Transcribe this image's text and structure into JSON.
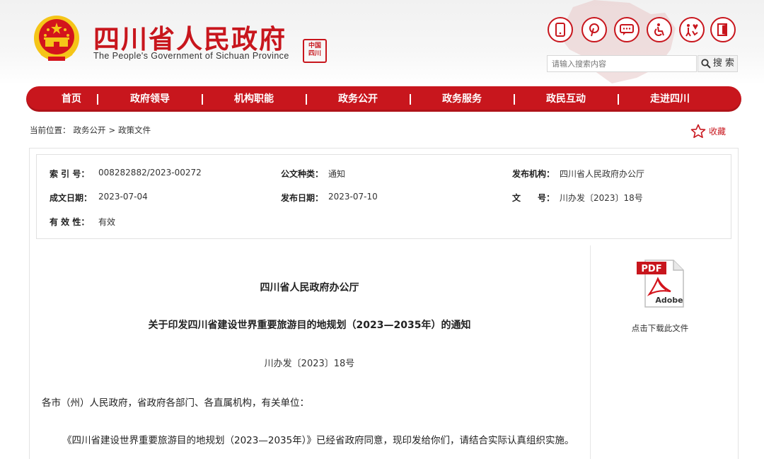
{
  "header": {
    "title": "四川省人民政府",
    "subtitle": "The People's Government of Sichuan Province",
    "seal_text": "中国四川",
    "icons": [
      "mobile-icon",
      "pinterest-icon",
      "message-icon",
      "accessibility-icon",
      "care-icon",
      "exit-icon"
    ]
  },
  "search": {
    "placeholder": "请输入搜索内容",
    "button_label": "搜 索"
  },
  "nav": {
    "items": [
      {
        "label": "首页"
      },
      {
        "label": "政府领导"
      },
      {
        "label": "机构职能"
      },
      {
        "label": "政务公开"
      },
      {
        "label": "政务服务"
      },
      {
        "label": "政民互动"
      },
      {
        "label": "走进四川"
      }
    ]
  },
  "breadcrumb": {
    "prefix": "当前位置：",
    "items": [
      "政务公开",
      "政策文件"
    ],
    "separator": ">"
  },
  "favorite_label": "收藏",
  "meta": {
    "index_label": "索 引 号：",
    "index_value": "008282882/2023-00272",
    "category_label": "公文种类：",
    "category_value": "通知",
    "issuer_label": "发布机构：",
    "issuer_value": "四川省人民政府办公厅",
    "created_label": "成文日期：",
    "created_value": "2023-07-04",
    "published_label": "发布日期：",
    "published_value": "2023-07-10",
    "docno_label": "文　　号：",
    "docno_value": "川办发〔2023〕18号",
    "validity_label": "有 效 性：",
    "validity_value": "有效"
  },
  "document": {
    "issuer": "四川省人民政府办公厅",
    "title": "关于印发四川省建设世界重要旅游目的地规划（2023—2035年）的通知",
    "number": "川办发〔2023〕18号",
    "salutation": "各市（州）人民政府，省政府各部门、各直属机构，有关单位：",
    "body": "《四川省建设世界重要旅游目的地规划（2023—2035年）》已经省政府同意，现印发给你们，请结合实际认真组织实施。"
  },
  "download": {
    "pdf_badge": "PDF",
    "brand": "Adobe",
    "label": "点击下载此文件"
  },
  "colors": {
    "brand_red": "#c8161d",
    "gold": "#f5c518"
  }
}
